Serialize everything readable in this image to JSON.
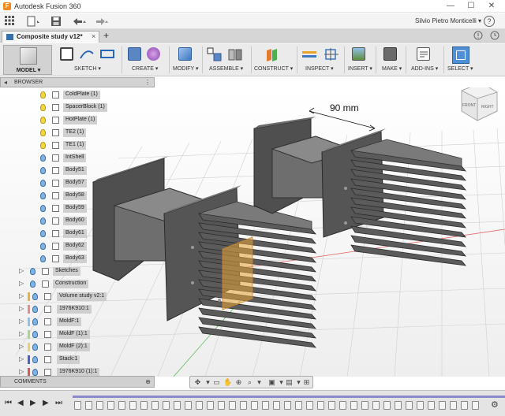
{
  "window": {
    "app_icon_letter": "F",
    "title": "Autodesk Fusion 360",
    "minimize_glyph": "—",
    "maximize_glyph": "☐",
    "close_glyph": "✕"
  },
  "quick_access": {
    "file_icon": "file-icon",
    "save_icon": "save-icon",
    "undo_icon": "undo-icon",
    "redo_icon": "redo-icon",
    "user_name": "Silvio Pietro Monticelli ▾",
    "help_glyph": "?"
  },
  "document_tab": {
    "label": "Composite study v12*",
    "close_glyph": "×",
    "new_tab_glyph": "+"
  },
  "ribbon": {
    "workspace_label": "MODEL ▾",
    "groups": [
      {
        "label": "SKETCH ▾"
      },
      {
        "label": "CREATE ▾"
      },
      {
        "label": "MODIFY ▾"
      },
      {
        "label": "ASSEMBLE ▾"
      },
      {
        "label": "CONSTRUCT ▾"
      },
      {
        "label": "INSPECT ▾"
      },
      {
        "label": "INSERT ▾"
      },
      {
        "label": "MAKE ▾"
      },
      {
        "label": "ADD-INS ▾"
      },
      {
        "label": "SELECT ▾"
      }
    ]
  },
  "browser": {
    "header_label": "BROWSER",
    "bodies": [
      {
        "label": "ColdPlate (1)"
      },
      {
        "label": "SpacerBlock (1)"
      },
      {
        "label": "HotPlate (1)"
      },
      {
        "label": "TE2 (1)"
      },
      {
        "label": "TE1 (1)"
      },
      {
        "label": "IntShell"
      },
      {
        "label": "Body51"
      },
      {
        "label": "Body57"
      },
      {
        "label": "Body58"
      },
      {
        "label": "Body59"
      },
      {
        "label": "Body60"
      },
      {
        "label": "Body61"
      },
      {
        "label": "Body62"
      },
      {
        "label": "Body63"
      }
    ],
    "nodes": [
      {
        "label": "Sketches"
      },
      {
        "label": "Construction"
      },
      {
        "label": "Volume study v2:1"
      },
      {
        "label": "1976K910:1"
      },
      {
        "label": "MoldF:1"
      },
      {
        "label": "MoldF (1):1"
      },
      {
        "label": "MoldF (2):1"
      },
      {
        "label": "Stack:1"
      },
      {
        "label": "1976K910 (1):1"
      }
    ]
  },
  "viewport": {
    "dimension_label": "90 mm",
    "viewcube_front": "FRONT",
    "viewcube_right": "RIGHT"
  },
  "comments": {
    "label": "COMMENTS"
  },
  "colors": {
    "accent_blue": "#4e8fd6",
    "bulb_yellow": "#f2d640",
    "bulb_blue": "#7fb3e6",
    "part_dark": "#4d4d4d",
    "highlight_orange": "#e9a53a"
  }
}
